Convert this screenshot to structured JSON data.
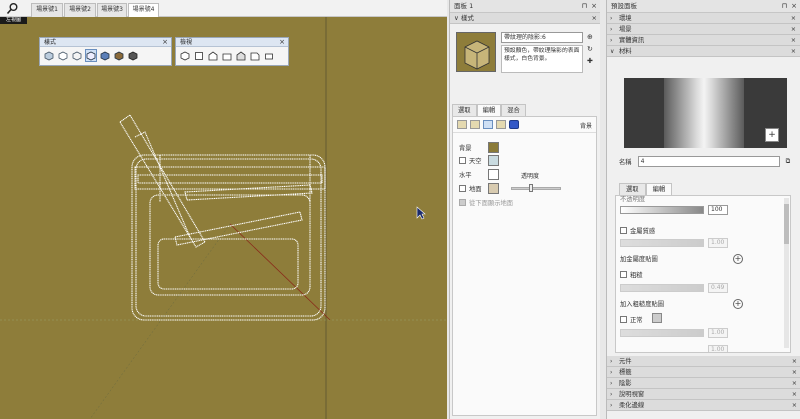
{
  "scene_tabs": [
    "場景號1",
    "場景號2",
    "場景號3",
    "場景號4"
  ],
  "viewport": {
    "corner_label": "左視圖"
  },
  "toolbars": {
    "style_title": "樣式",
    "view_title": "檢視"
  },
  "panel1": {
    "title": "面板 1",
    "section_title": "樣式",
    "style_name": "帶紋理的陰影:6",
    "style_desc": "預設顏色，帶紋理陰影的表面樣式，白色背景。",
    "tabs": [
      "選取",
      "編輯",
      "混合"
    ],
    "bg_label": "背景",
    "rows": {
      "background": "背景",
      "sky": "天空",
      "horizon": "水平",
      "ground": "地面",
      "transparency": "透明度",
      "show_below": "從下面顯示地面"
    },
    "colors": {
      "background": "#8a7a38",
      "sky": "#c9dbe0",
      "horizon": "#ffffff",
      "ground": "#d8cbb0"
    }
  },
  "default_panel": {
    "title": "預設面板",
    "sections_top": [
      "環境",
      "場景",
      "實體資訊"
    ],
    "materials_title": "材料",
    "name_label": "名稱",
    "name_value": "4",
    "tabs": [
      "選取",
      "編輯"
    ],
    "edit": {
      "opacity_label": "不透明度",
      "opacity_value": "100",
      "metal_label": "金屬質感",
      "metal_value": "1.00",
      "add_metal_map": "加金屬度貼圖",
      "rough_label": "粗糙",
      "rough_value": "0.49",
      "add_rough_map": "加入粗糙度貼圖",
      "normal_label": "正常",
      "normal_value": "1.00",
      "ao_value": "1.00"
    },
    "sections_bottom": [
      "元件",
      "標籤",
      "陰影",
      "說明視窗",
      "柔化邊線"
    ]
  }
}
